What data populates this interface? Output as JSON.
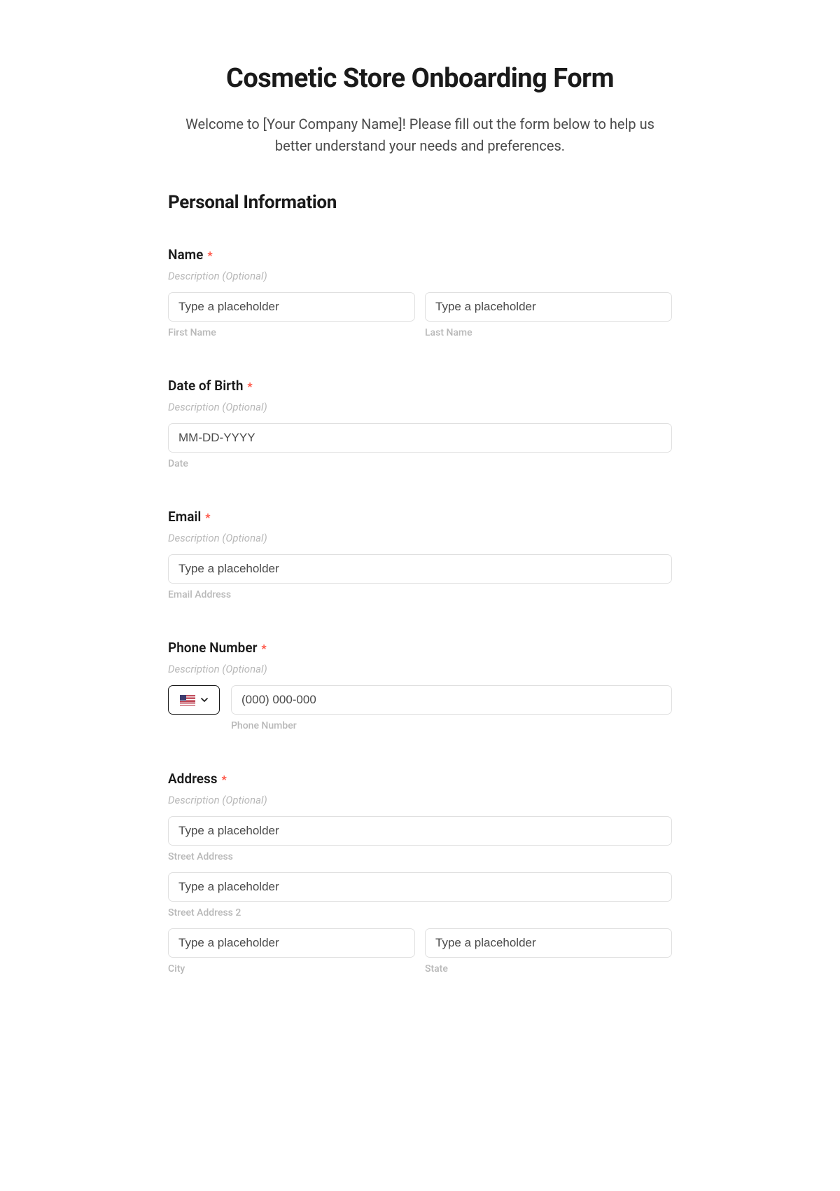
{
  "form": {
    "title": "Cosmetic Store Onboarding Form",
    "intro": "Welcome to [Your Company Name]! Please fill out the form below to help us better understand your needs and preferences.",
    "section_heading": "Personal Information",
    "description_placeholder": "Description (Optional)",
    "generic_placeholder": "Type a placeholder",
    "required_star": "*",
    "fields": {
      "name": {
        "label": "Name",
        "first_sub": "First Name",
        "last_sub": "Last Name"
      },
      "dob": {
        "label": "Date of Birth",
        "placeholder": "MM-DD-YYYY",
        "sub": "Date"
      },
      "email": {
        "label": "Email",
        "sub": "Email Address"
      },
      "phone": {
        "label": "Phone Number",
        "placeholder": "(000) 000-000",
        "sub": "Phone Number"
      },
      "address": {
        "label": "Address",
        "street_sub": "Street Address",
        "street2_sub": "Street Address 2",
        "city_sub": "City",
        "state_sub": "State"
      }
    }
  }
}
